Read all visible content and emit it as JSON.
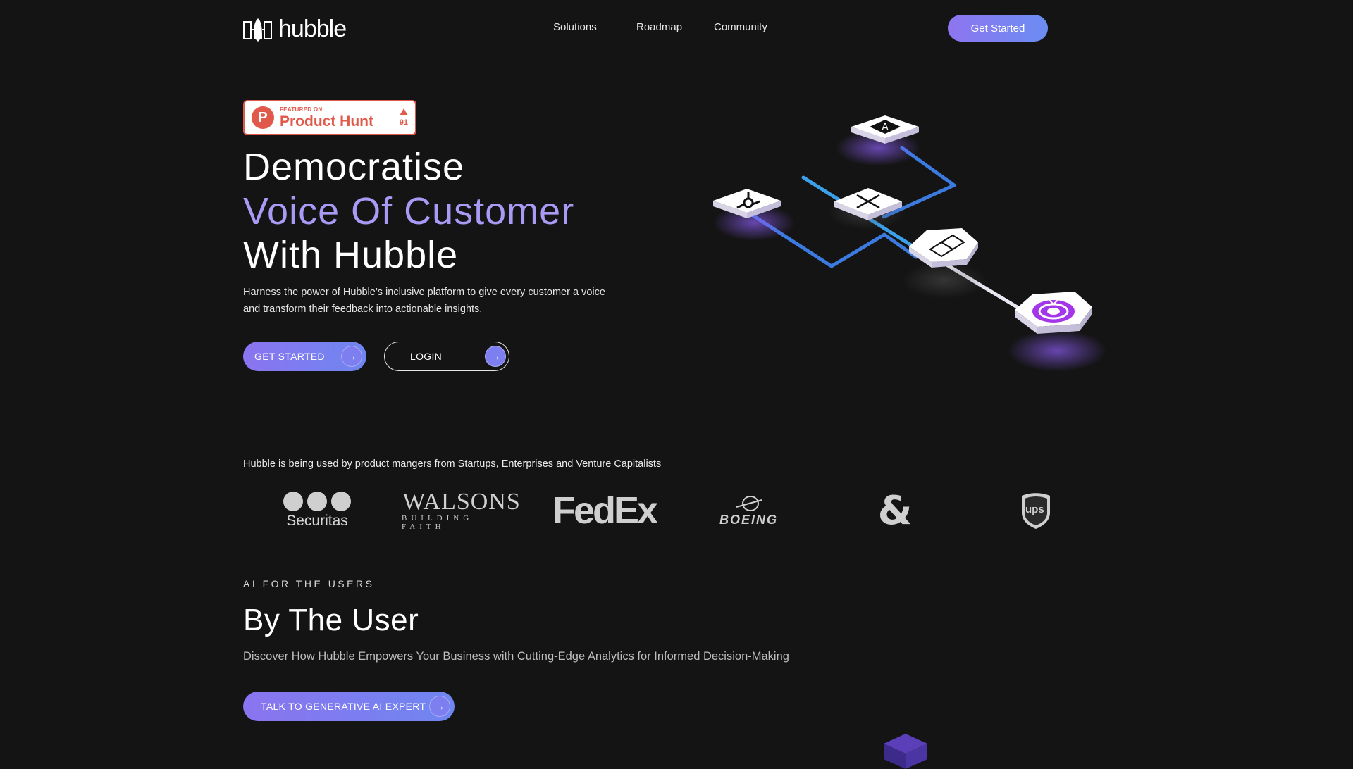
{
  "brand": {
    "name": "hubble"
  },
  "nav": {
    "links": [
      "Solutions",
      "Roadmap",
      "Community"
    ],
    "cta": "Get Started"
  },
  "product_hunt": {
    "featured": "FEATURED ON",
    "name": "Product Hunt",
    "votes": "91"
  },
  "hero": {
    "line1": "Democratise",
    "line2": "Voice Of Customer",
    "line3": "With Hubble",
    "subtitle_1": "Harness the power of Hubble’s inclusive platform to give every customer a voice",
    "subtitle_2": "and transform their feedback into actionable insights.",
    "primary_button": "GET STARTED",
    "secondary_button": "LOGIN"
  },
  "illustration": {
    "nodes": [
      "app-store-icon",
      "hubspot-icon",
      "x-icon",
      "hubble-logo-icon",
      "target-icon"
    ],
    "colors": {
      "accent": "#a36cf0",
      "line": "#3b7be0",
      "line_light": "#e8e8f4"
    }
  },
  "customers": {
    "caption": "Hubble is being used by product mangers from Startups, Enterprises and Venture Capitalists",
    "securitas": "Securitas",
    "walsons": "WALSONS",
    "walsons_tag": "BUILDING FAITH",
    "fedex": "FedEx",
    "boeing": "BOEING",
    "ups": "ups"
  },
  "section2": {
    "eyebrow": "AI FOR THE USERS",
    "title": "By The User",
    "subtitle": "Discover How Hubble Empowers Your Business with Cutting-Edge Analytics for Informed Decision-Making",
    "button": "TALK TO GENERATIVE AI EXPERT"
  },
  "colors": {
    "background": "#141414",
    "accent": "#a99af5",
    "gradient_start": "#8a74ef",
    "gradient_end": "#6f86f0"
  }
}
